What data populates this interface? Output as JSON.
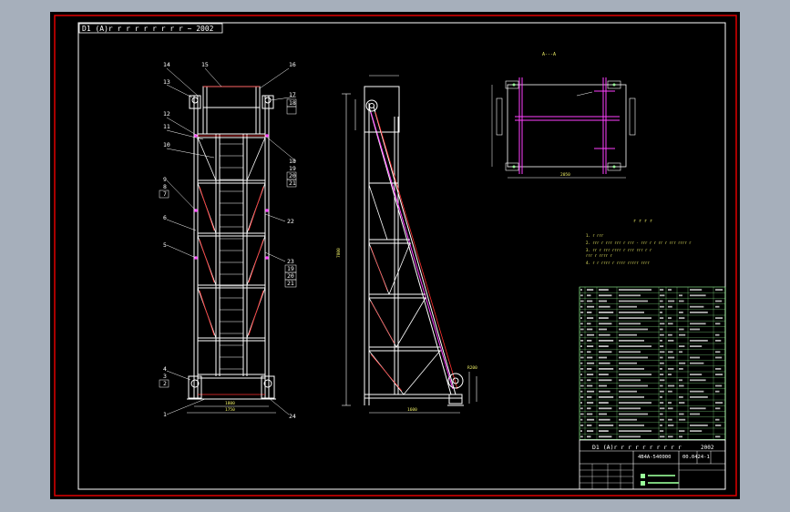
{
  "title_block": {
    "header_text": "D1 (A)r r r r r r r r r    ~ 2002",
    "project_name": "D1 (A)r r r r r r r r r r",
    "year": "2002",
    "drawing_no": "00.0424-1",
    "model": "4B4A-540000"
  },
  "top_view": {
    "title": "A---A"
  },
  "tech_notes": {
    "title": "r r r r",
    "lines": [
      "1. r   rrr",
      "2. rrr r rrr rrr r rrr - rrr r      r rr r rrr rrrr r",
      "3. rr r rrr rrrr r  rrr rrr r r",
      "   rrr r rrrr r",
      "4. r r rrrr r rrrr rrrrr               rrrr"
    ]
  },
  "part_labels": {
    "front": [
      "14",
      "15",
      "16",
      "13",
      "17",
      "18",
      "12",
      "11",
      "10",
      "18",
      "19",
      "20",
      "21",
      "9",
      "8",
      "7",
      "6",
      "22",
      "5",
      "23",
      "19",
      "20",
      "21",
      "4",
      "3",
      "2",
      "1",
      "24"
    ]
  },
  "dimensions": {
    "front_bottom_inner": "1800",
    "front_bottom_outer": "1750",
    "side_bottom": "1600",
    "side_height": "7800",
    "top_view_width": "2050",
    "detail_r": "R200"
  }
}
